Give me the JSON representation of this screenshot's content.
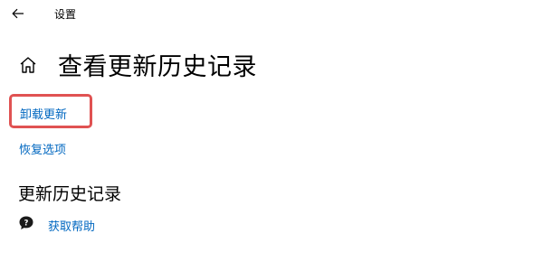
{
  "window": {
    "title": "设置"
  },
  "page": {
    "title": "查看更新历史记录"
  },
  "links": {
    "uninstall_updates": "卸载更新",
    "recovery_options": "恢复选项"
  },
  "update_history": {
    "heading": "更新历史记录"
  },
  "help": {
    "label": "获取帮助"
  },
  "colors": {
    "link": "#0067c0",
    "highlight": "#e05252"
  }
}
